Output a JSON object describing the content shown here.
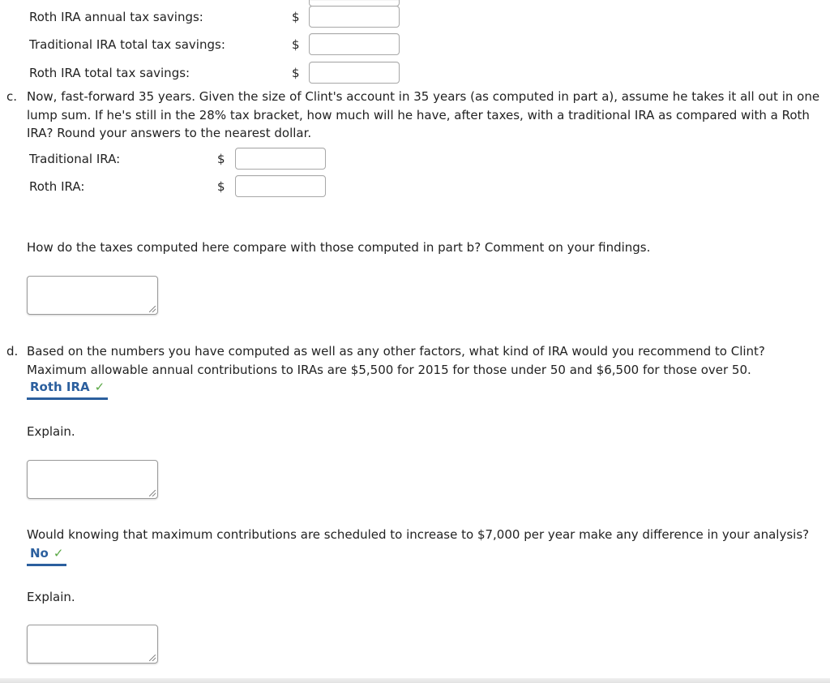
{
  "part_b_rows": [
    {
      "label": "Roth IRA annual tax savings:",
      "currency": "$",
      "value": ""
    },
    {
      "label": "Traditional IRA total tax savings:",
      "currency": "$",
      "value": ""
    },
    {
      "label": "Roth IRA total tax savings:",
      "currency": "$",
      "value": ""
    }
  ],
  "part_c": {
    "letter": "c.",
    "question": "Now, fast-forward 35 years. Given the size of Clint's account in 35 years (as computed in part a), assume he takes it all out in one lump sum. If he's still in the 28% tax bracket, how much will he have, after taxes, with a traditional IRA as compared with a Roth IRA? Round your answers to the nearest dollar.",
    "rows": [
      {
        "label": "Traditional IRA:",
        "currency": "$",
        "value": ""
      },
      {
        "label": "Roth IRA:",
        "currency": "$",
        "value": ""
      }
    ],
    "compare_question": "How do the taxes computed here compare with those computed in part b? Comment on your findings.",
    "compare_answer": ""
  },
  "part_d": {
    "letter": "d.",
    "question": "Based on the numbers you have computed as well as any other factors, what kind of IRA would you recommend to Clint? Maximum allowable annual contributions to IRAs are $5,500 for 2015 for those under 50 and $6,500 for those over 50.",
    "selected_answer": "Roth IRA",
    "answer_status": "correct",
    "check_glyph": "✓",
    "explain_label": "Explain.",
    "explain_answer": "",
    "followup_question": "Would knowing that maximum contributions are scheduled to increase to $7,000 per year make any difference in your analysis?",
    "followup_answer": "No",
    "followup_status": "correct",
    "followup_explain_label": "Explain.",
    "followup_explain_answer": ""
  },
  "colors": {
    "answer_blue": "#2b5f9e",
    "check_green": "#5aa845"
  }
}
